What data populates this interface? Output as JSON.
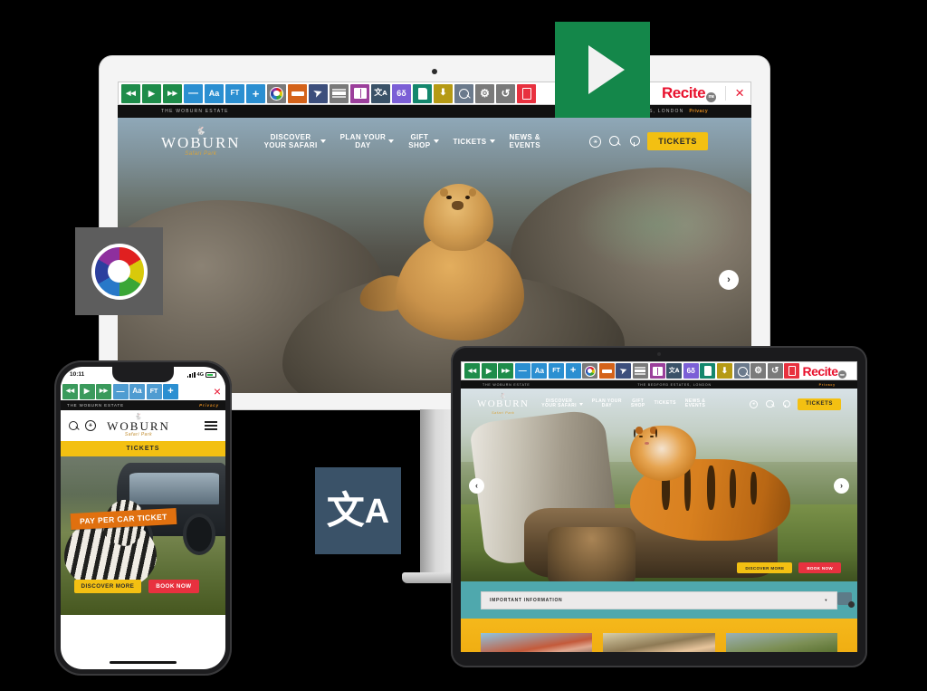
{
  "product": {
    "brand": "Recite",
    "brand_trademark": "me"
  },
  "toolbar": {
    "close_label": "×",
    "buttons": [
      {
        "name": "rewind-button",
        "glyph": "◀◀",
        "color": "#1e8c4a",
        "title": "Rewind"
      },
      {
        "name": "play-button",
        "glyph": "▶",
        "color": "#1e8c4a",
        "title": "Play"
      },
      {
        "name": "forward-button",
        "glyph": "▶▶",
        "color": "#1e8c4a",
        "title": "Forward"
      },
      {
        "name": "decrease-text-button",
        "glyph": "—",
        "color": "#2b8fd1",
        "title": "Decrease text size"
      },
      {
        "name": "font-style-button",
        "glyph": "Aa",
        "color": "#2b8fd1",
        "title": "Font style"
      },
      {
        "name": "plain-text-button",
        "glyph": "FT",
        "color": "#2b8fd1",
        "title": "Plain text"
      },
      {
        "name": "increase-text-button",
        "glyph": "+",
        "color": "#2b8fd1",
        "title": "Increase text size"
      },
      {
        "name": "colour-wheel-button",
        "glyph": "wheel",
        "color": "#7a7a7a",
        "title": "Change colours"
      },
      {
        "name": "ruler-button",
        "glyph": "ruler",
        "color": "#d4631a",
        "title": "Ruler"
      },
      {
        "name": "cursor-button",
        "glyph": "➤",
        "color": "#3d4f7c",
        "title": "Magnify cursor"
      },
      {
        "name": "screen-mask-button",
        "glyph": "mask",
        "color": "#7a7a7a",
        "title": "Screen mask"
      },
      {
        "name": "dictionary-button",
        "glyph": "book",
        "color": "#9b3f9b",
        "title": "Dictionary"
      },
      {
        "name": "translate-button",
        "glyph": "文A",
        "color": "#3a5268",
        "title": "Translate"
      },
      {
        "name": "reading-aid-button",
        "glyph": "6δ",
        "color": "#7b5fd6",
        "title": "Reading aid"
      },
      {
        "name": "page-style-button",
        "glyph": "page",
        "color": "#14876d",
        "title": "Page style"
      },
      {
        "name": "download-button",
        "glyph": "⬇",
        "color": "#b59a14",
        "title": "Download audio"
      },
      {
        "name": "magnifier-button",
        "glyph": "⌕",
        "color": "#6b7a8c",
        "title": "Magnifier"
      },
      {
        "name": "settings-button",
        "glyph": "⚙",
        "color": "#7a7a7a",
        "title": "Settings"
      },
      {
        "name": "reset-button",
        "glyph": "↺",
        "color": "#7a7a7a",
        "title": "Reset"
      },
      {
        "name": "docreader-button",
        "glyph": "doc",
        "color": "#e8313f",
        "title": "Document reader"
      }
    ],
    "mobile_buttons": [
      {
        "name": "rewind-button",
        "glyph": "◀◀",
        "color": "#3a9a5c"
      },
      {
        "name": "play-button",
        "glyph": "▶",
        "color": "#3a9a5c"
      },
      {
        "name": "forward-button",
        "glyph": "▶▶",
        "color": "#3a9a5c"
      },
      {
        "name": "decrease-text-button",
        "glyph": "—",
        "color": "#4f9cd1"
      },
      {
        "name": "font-style-button",
        "glyph": "Aa",
        "color": "#4f9cd1"
      },
      {
        "name": "plain-text-button",
        "glyph": "FT",
        "color": "#4f9cd1"
      },
      {
        "name": "increase-text-button",
        "glyph": "+",
        "color": "#2b8fd1"
      }
    ]
  },
  "badges": [
    {
      "name": "play-feature-badge",
      "icon": "play-icon",
      "color": "#14874a"
    },
    {
      "name": "colour-wheel-feature-badge",
      "icon": "colour-wheel-icon",
      "color": "#5d5d5d"
    },
    {
      "name": "translate-feature-badge",
      "icon": "translate-icon",
      "color": "#3a5268",
      "cn": "文",
      "en": "A"
    }
  ],
  "site": {
    "estate_left": "THE WOBURN ESTATE",
    "estate_right": "THE BEDFORD ESTATES, LONDON",
    "privacy": "Privacy",
    "brand_word": "WOBURN",
    "brand_sub": "Safari Park",
    "nav": [
      {
        "label": "DISCOVER\nYOUR SAFARI",
        "chevron": true
      },
      {
        "label": "PLAN YOUR\nDAY",
        "chevron": true
      },
      {
        "label": "GIFT\nSHOP",
        "chevron": true
      },
      {
        "label": "TICKETS",
        "chevron": true
      },
      {
        "label": "NEWS &\nEVENTS",
        "chevron": false
      }
    ],
    "tickets_button": "TICKETS",
    "accessibility_icon": "accessibility-icon",
    "search_icon": "search-icon",
    "location_icon": "location-pin-icon",
    "carousel_next": "›",
    "carousel_prev": "‹"
  },
  "mobile": {
    "status_time": "10:11",
    "status_network": "4G",
    "tickets_bar": "TICKETS",
    "hero_ribbon": "PAY PER CAR TICKET",
    "cta_primary": "DISCOVER MORE",
    "cta_secondary": "BOOK NOW",
    "close_label": "×"
  },
  "tablet": {
    "cta_primary": "DISCOVER MORE",
    "cta_secondary": "BOOK NOW",
    "info_label": "IMPORTANT INFORMATION",
    "info_toggle": "▼",
    "cards": [
      {
        "name": "card-one"
      },
      {
        "name": "card-two"
      },
      {
        "name": "card-three"
      }
    ]
  },
  "colors": {
    "green": "#1e8c4a",
    "blue": "#2b8fd1",
    "recite_red": "#e8112d",
    "woburn_yellow": "#f3c012",
    "teal": "#4fa8ad",
    "orange": "#e0700f"
  }
}
